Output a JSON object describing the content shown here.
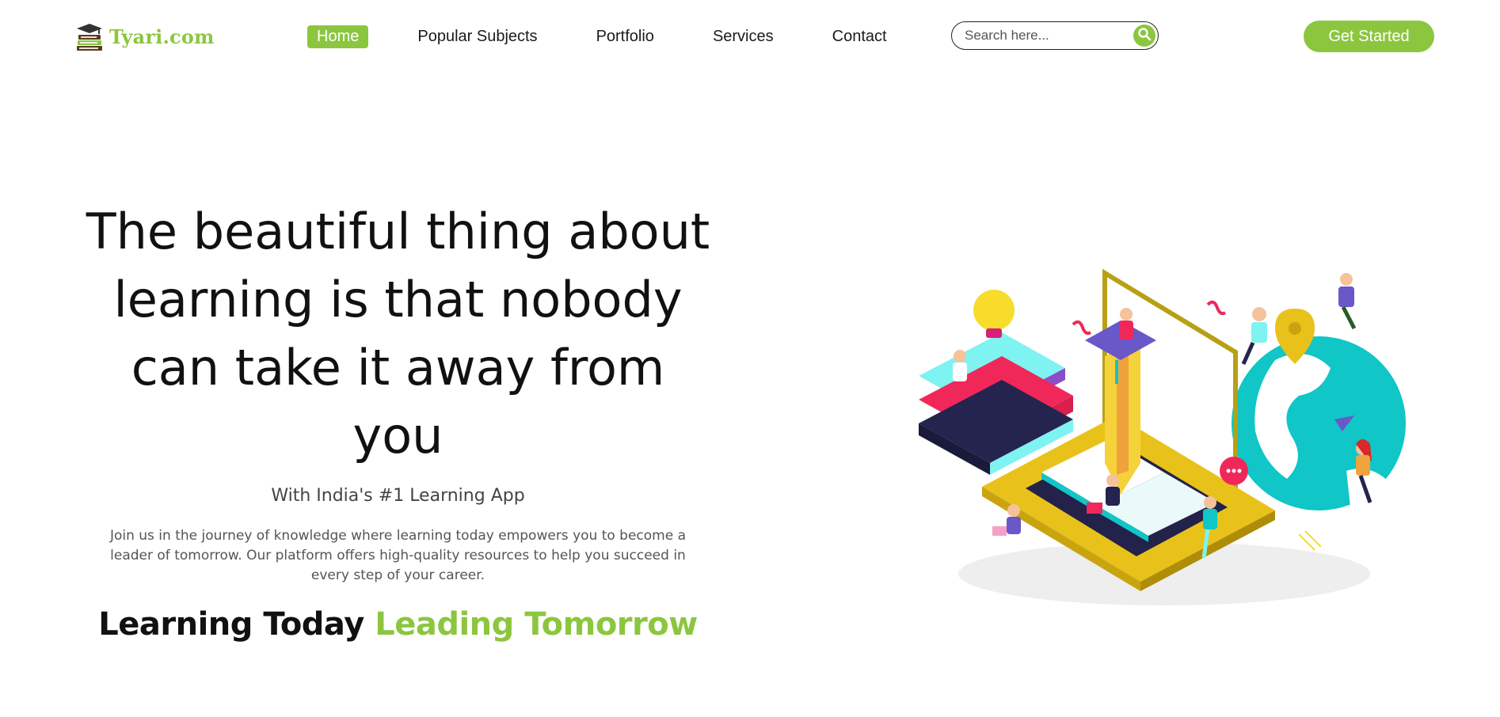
{
  "header": {
    "brand": "Tyari.com",
    "nav": [
      {
        "label": "Home",
        "active": true
      },
      {
        "label": "Popular Subjects",
        "active": false
      },
      {
        "label": "Portfolio",
        "active": false
      },
      {
        "label": "Services",
        "active": false
      },
      {
        "label": "Contact",
        "active": false
      }
    ],
    "search": {
      "placeholder": "Search here...",
      "value": ""
    },
    "cta_label": "Get Started"
  },
  "hero": {
    "headline_lines": [
      "The beautiful thing about",
      "learning is that nobody",
      "can take it away from you"
    ],
    "subtitle": "With India's #1 Learning App",
    "description": "Join us in the journey of knowledge where learning today empowers you to become a leader of tomorrow. Our platform offers high-quality resources to help you succeed in every step of your career.",
    "tagline_dark": "Learning Today",
    "tagline_green": "Leading Tomorrow"
  },
  "colors": {
    "accent": "#8cc63f",
    "text": "#111111",
    "muted": "#555555"
  },
  "icons": {
    "logo": "graduation-books-icon",
    "search": "search-icon"
  }
}
